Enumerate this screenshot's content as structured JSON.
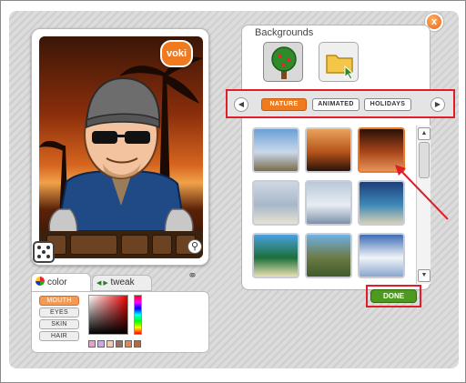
{
  "header": {
    "close_label": "x"
  },
  "avatar": {
    "brand_badge": "voki"
  },
  "editor_tabs": {
    "color_label": "color",
    "tweak_label": "tweak"
  },
  "parts": [
    {
      "label": "MOUTH",
      "active": true
    },
    {
      "label": "EYES",
      "active": false
    },
    {
      "label": "SKIN",
      "active": false
    },
    {
      "label": "HAIR",
      "active": false
    }
  ],
  "swatches": [
    "#e6a3c7",
    "#c9a7e8",
    "#f5c9b3",
    "#9a6f5c",
    "#d88a58",
    "#b46a3a"
  ],
  "backgrounds": {
    "title": "Backgrounds",
    "categories": [
      {
        "icon": "tree-icon",
        "active": true
      },
      {
        "icon": "folder-icon",
        "active": false
      }
    ],
    "filters": [
      {
        "label": "NATURE",
        "active": true
      },
      {
        "label": "ANIMATED",
        "active": false
      },
      {
        "label": "HOLIDAYS",
        "active": false
      }
    ],
    "thumbnails": [
      {
        "name": "mountain-lake",
        "colors": [
          "#6ba0d6",
          "#c9d9ea",
          "#7a6b4b"
        ],
        "selected": false
      },
      {
        "name": "sunset-sea",
        "colors": [
          "#e9a25a",
          "#b4531a",
          "#2a1307"
        ],
        "selected": false
      },
      {
        "name": "palm-sunset",
        "colors": [
          "#2a1106",
          "#a9461a",
          "#e8935b"
        ],
        "selected": true
      },
      {
        "name": "sand-dunes",
        "colors": [
          "#cfd8e4",
          "#a7b7ca",
          "#e9e2d3"
        ],
        "selected": false
      },
      {
        "name": "snow-field",
        "colors": [
          "#b9c8d8",
          "#e7edf3",
          "#7e92aa"
        ],
        "selected": false
      },
      {
        "name": "tropical-beach",
        "colors": [
          "#1c3f7a",
          "#3e89b8",
          "#d7d0b4"
        ],
        "selected": false
      },
      {
        "name": "palm-tree",
        "colors": [
          "#4aa0e0",
          "#1c6f3a",
          "#eadfb0"
        ],
        "selected": false
      },
      {
        "name": "rock-cliff",
        "colors": [
          "#6fb0e4",
          "#6c7a45",
          "#3e5a2b"
        ],
        "selected": false
      },
      {
        "name": "snowy-peak",
        "colors": [
          "#3d6cb4",
          "#f1f4f8",
          "#8aa6cf"
        ],
        "selected": false
      }
    ],
    "done_label": "DONE"
  }
}
